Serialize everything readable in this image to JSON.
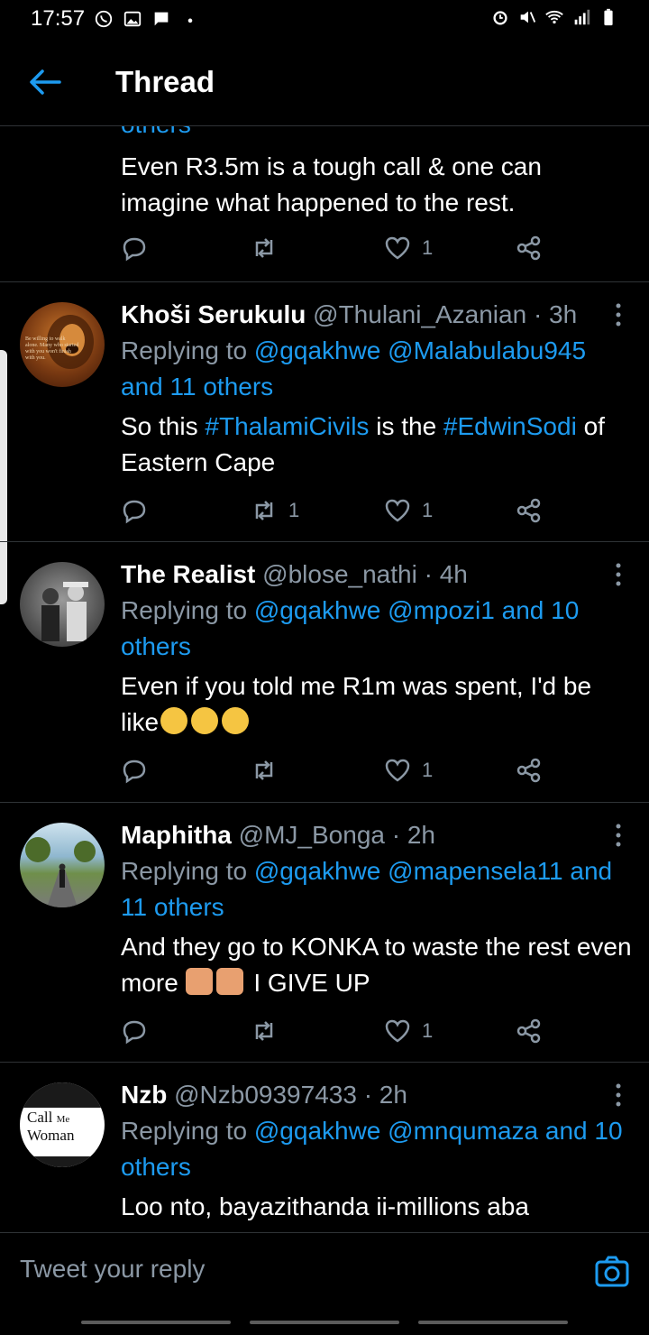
{
  "status_bar": {
    "time": "17:57"
  },
  "header": {
    "title": "Thread"
  },
  "tweets": [
    {
      "partial_top": "others",
      "text": "Even R3.5m is a tough call & one can imagine what happened to the rest.",
      "retweets": "",
      "likes": "1"
    },
    {
      "name": "Khoši Serukulu",
      "handle": "@Thulani_Azanian",
      "time": "· 3h",
      "replying_prefix": "Replying to",
      "replying_to": "@gqakhwe @Malabulabu945 and 11 others",
      "text_a": "So this ",
      "tag1": "#ThalamiCivils",
      "text_b": " is the ",
      "tag2": "#EdwinSodi",
      "text_c": " of Eastern Cape",
      "retweets": "1",
      "likes": "1"
    },
    {
      "name": "The Realist",
      "handle": "@blose_nathi",
      "time": "· 4h",
      "replying_prefix": "Replying to",
      "replying_to": "@gqakhwe @mpozi1 and 10 others",
      "text": "Even if you told me R1m was spent, I'd be like",
      "retweets": "",
      "likes": "1"
    },
    {
      "name": "Maphitha",
      "handle": "@MJ_Bonga",
      "time": "· 2h",
      "replying_prefix": "Replying to",
      "replying_to": "@gqakhwe @mapensela11 and 11 others",
      "text_a": "And they go to KONKA to waste the rest even more ",
      "text_b": " I GIVE UP",
      "retweets": "",
      "likes": "1"
    },
    {
      "name": "Nzb",
      "handle": "@Nzb09397433",
      "time": "· 2h",
      "replying_prefix": "Replying to",
      "replying_to": "@gqakhwe @mnqumaza and 10 others",
      "text": "Loo nto, bayazithanda ii-millions aba"
    }
  ],
  "avatar_text": {
    "quote": "Be willing to walk alone. Many who started with you won't finish with you.",
    "book_title_1": "Call",
    "book_title_2": "Me",
    "book_title_3": "Woman"
  },
  "compose": {
    "placeholder": "Tweet your reply"
  },
  "colors": {
    "accent": "#1d9bf0",
    "muted": "#8b98a5",
    "divider": "#2f3336"
  }
}
